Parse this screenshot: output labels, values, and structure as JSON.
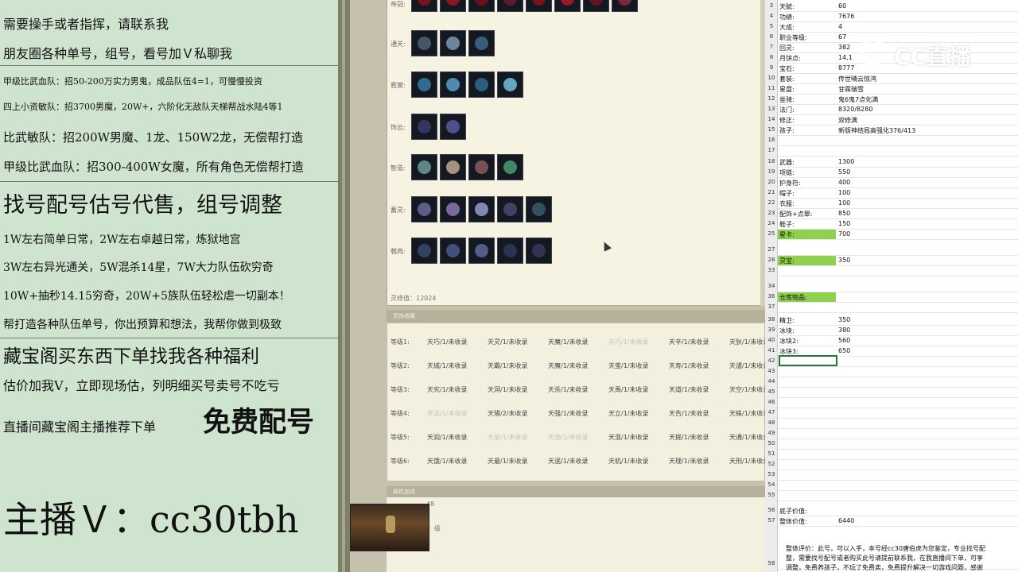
{
  "left_panel": {
    "lines": [
      "需要操手或者指挥，请联系我",
      "朋友圈各种单号，组号，看号加Ｖ私聊我",
      "甲级比武血队：招50-200万实力男鬼，成品队伍4=1，可慢慢投资",
      "四上小资敏队：招3700男魔，20W+，六阶化无敌队天梯帮战水陆4等1",
      "比武敏队：招200W男魔、1龙、150W2龙，无偿帮打造",
      "甲级比武血队：招300-400W女魔，所有角色无偿帮打造",
      "找号配号估号代售，组号调整",
      "1W左右简单日常，2W左右卓越日常，炼狱地宫",
      "3W左右异光通关，5W混杀14星，7W大力队伍砍穷奇",
      "10W+抽秒14.15穷奇，20W+5族队伍轻松虐一切副本！",
      "帮打造各种队伍单号，你出预算和想法，我帮你做到极致",
      "藏宝阁买东西下单找我各种福利",
      "估价加我V，立即现场估，列明细买号卖号不吃亏",
      "直播间藏宝阁主播推荐下单",
      "免费配号",
      "主播Ｖ：cc30tbh"
    ]
  },
  "game": {
    "row_labels": [
      "帝冠:",
      "通天:",
      "霓裳:",
      "饰云:",
      "智造:",
      "蓄灵:",
      "戟冉:"
    ],
    "value_line": "灵修值：12024",
    "grid_header": "灵饰收藏",
    "grid_rows": [
      {
        "label": "等级1:",
        "cells": [
          "天巧/1/未收录",
          "天灵/1/未收录",
          "天魔/1/未收录",
          "天巧/1/未收录",
          "天辛/1/未收录",
          "天狄/1/未收录"
        ]
      },
      {
        "label": "等级2:",
        "cells": [
          "天城/1/未收录",
          "天霸/1/未收录",
          "天魔/1/未收录",
          "天蚩/1/未收录",
          "天寿/1/未收录",
          "天谴/1/未收录"
        ]
      },
      {
        "label": "等级3:",
        "cells": [
          "天究/1/未收录",
          "天洞/1/未收录",
          "天杀/1/未收录",
          "天禹/1/未收录",
          "天道/1/未收录",
          "天空/1/未收录"
        ]
      },
      {
        "label": "等级4:",
        "cells": [
          "天凌/1/未收录",
          "天猎/2/未收录",
          "天强/1/未收录",
          "天立/1/未收录",
          "天告/1/未收录",
          "天蛛/1/未收录"
        ]
      },
      {
        "label": "等级5:",
        "cells": [
          "天润/1/未收录",
          "天星/1/未收录",
          "天弛/1/未收录",
          "天混/1/未收录",
          "天掘/1/未收录",
          "天通/1/未收录"
        ]
      },
      {
        "label": "等级6:",
        "cells": [
          "天饿/1/未收录",
          "天最/1/未收录",
          "天泯/1/未收录",
          "天机/1/未收录",
          "天理/1/未收录",
          "天刑/1/未收录"
        ]
      }
    ],
    "bottom_header": "属性加成",
    "bottom_value": "48",
    "bottom_unit": "级"
  },
  "sheet": {
    "rows": [
      {
        "n": "3",
        "k": "天赋:",
        "v": "60"
      },
      {
        "n": "4",
        "k": "功绩:",
        "v": "7676"
      },
      {
        "n": "5",
        "k": "大成:",
        "v": "4"
      },
      {
        "n": "6",
        "k": "职业等级:",
        "v": "67"
      },
      {
        "n": "7",
        "k": "回灵:",
        "v": "382"
      },
      {
        "n": "8",
        "k": "月饼点:",
        "v": "14,1"
      },
      {
        "n": "9",
        "k": "宝石:",
        "v": "8777"
      },
      {
        "n": "10",
        "k": "套装:",
        "v": "传世晴云惊鸿"
      },
      {
        "n": "11",
        "k": "星盘:",
        "v": "甘霖瑞雪"
      },
      {
        "n": "12",
        "k": "坐骑:",
        "v": "鬼6鬼7点化满"
      },
      {
        "n": "13",
        "k": "法门:",
        "v": "8320/8280"
      },
      {
        "n": "14",
        "k": "修正:",
        "v": "双修满"
      },
      {
        "n": "15",
        "k": "孩子:",
        "v": "新版神结局高强化376/413"
      },
      {
        "n": "16",
        "k": "",
        "v": ""
      },
      {
        "n": "17",
        "k": "",
        "v": ""
      },
      {
        "n": "18",
        "k": "武器:",
        "v": "1300"
      },
      {
        "n": "19",
        "k": "项链:",
        "v": "550"
      },
      {
        "n": "20",
        "k": "护身符:",
        "v": "400"
      },
      {
        "n": "21",
        "k": "帽子:",
        "v": "100"
      },
      {
        "n": "22",
        "k": "衣服:",
        "v": "100"
      },
      {
        "n": "23",
        "k": "配饰+点翠:",
        "v": "850"
      },
      {
        "n": "24",
        "k": "鞋子:",
        "v": "150"
      },
      {
        "n": "25",
        "k": "星卡:",
        "v": "700"
      },
      {
        "n": "27",
        "k": "",
        "v": ""
      },
      {
        "n": "28",
        "k": "灵宝:",
        "v": "350"
      },
      {
        "n": "33",
        "k": "",
        "v": ""
      },
      {
        "n": "34",
        "k": "",
        "v": ""
      },
      {
        "n": "36",
        "k": "仓库物品:",
        "v": ""
      },
      {
        "n": "37",
        "k": "",
        "v": ""
      },
      {
        "n": "38",
        "k": "精卫:",
        "v": "350"
      },
      {
        "n": "39",
        "k": "冰块:",
        "v": "380"
      },
      {
        "n": "40",
        "k": "冰块2:",
        "v": "560"
      },
      {
        "n": "41",
        "k": "冰块3:",
        "v": "650"
      },
      {
        "n": "42",
        "k": "",
        "v": ""
      },
      {
        "n": "43",
        "k": "",
        "v": ""
      },
      {
        "n": "44",
        "k": "",
        "v": ""
      },
      {
        "n": "45",
        "k": "",
        "v": ""
      },
      {
        "n": "46",
        "k": "",
        "v": ""
      },
      {
        "n": "47",
        "k": "",
        "v": ""
      },
      {
        "n": "48",
        "k": "",
        "v": ""
      },
      {
        "n": "49",
        "k": "",
        "v": ""
      },
      {
        "n": "50",
        "k": "",
        "v": ""
      },
      {
        "n": "51",
        "k": "",
        "v": ""
      },
      {
        "n": "52",
        "k": "",
        "v": ""
      },
      {
        "n": "53",
        "k": "",
        "v": ""
      },
      {
        "n": "54",
        "k": "",
        "v": ""
      },
      {
        "n": "55",
        "k": "",
        "v": ""
      },
      {
        "n": "56",
        "k": "底子价值:",
        "v": ""
      },
      {
        "n": "57",
        "k": "整体价值:",
        "v": "6440"
      },
      {
        "n": "58",
        "k": "",
        "v": ""
      }
    ],
    "evaluation": [
      "整体评价：此号，可以入手，本号经cc30唐伯虎为您鉴定，专业找号配",
      "整，需要找号配号或者购买此号请提前联系我，在我直播间下单，可享",
      "调整，免费养孩子，不玩了免费卖，免费提升解决一切游戏问题，感谢"
    ]
  },
  "logo": {
    "text": "CC直播"
  },
  "colors": {
    "left_bg": "#cfe4cf",
    "highlight": "#8fd14f",
    "selection": "#1f7a3a"
  }
}
